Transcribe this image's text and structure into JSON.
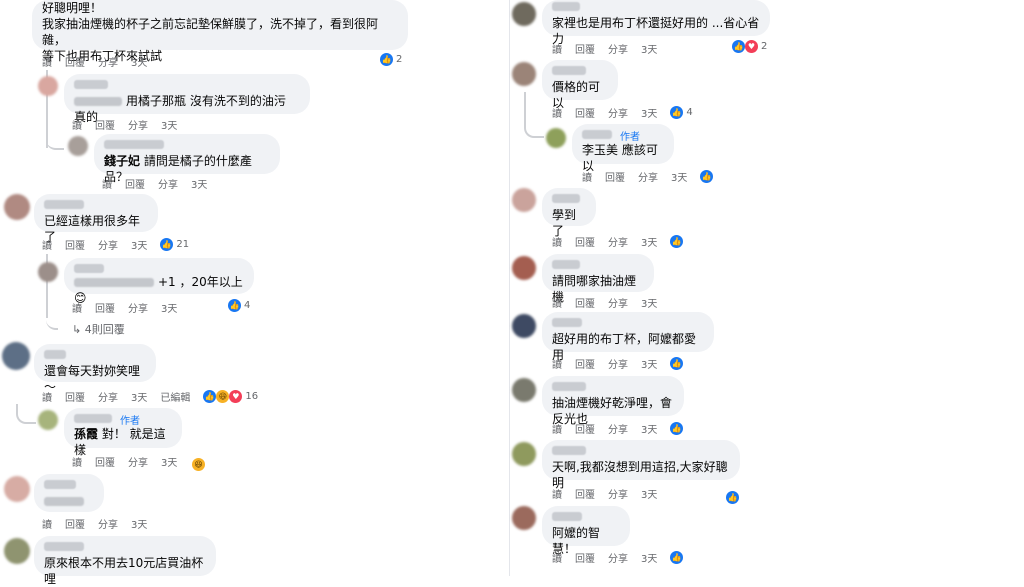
{
  "actions": {
    "read": "讀",
    "reply": "回覆",
    "share": "分享",
    "edited": "已編輯",
    "author": "作者"
  },
  "left": {
    "c1": {
      "line1": "好聰明哩！",
      "line2": "我家抽油煙機的杯子之前忘記墊保鮮膜了，洗不掉了，看到很阿雜，",
      "line3": "等下也用布丁杯來試試",
      "time": "3天",
      "count": "2"
    },
    "c2": {
      "text": "用橘子那瓶 沒有洗不到的油污 真的",
      "time": "3天"
    },
    "c3": {
      "mention": "錢子妃",
      "text": "請問是橘子的什麼產品？",
      "time": "3天"
    },
    "c4": {
      "text": "已經這樣用很多年了",
      "time": "3天",
      "count": "21"
    },
    "c5": {
      "text": "+1 ，20年以上😊",
      "time": "3天",
      "count": "4"
    },
    "more": {
      "text": "4則回覆"
    },
    "c6": {
      "text": "還會每天對妳笑哩～",
      "time": "3天",
      "count": "16"
    },
    "c7": {
      "mention": "孫霞",
      "text": "對！ 就是這樣",
      "time": "3天"
    },
    "c8": {
      "time": "3天"
    },
    "c9": {
      "text": "原來根本不用去10元店買油杯哩"
    }
  },
  "right": {
    "r1": {
      "text": "家裡也是用布丁杯還挺好用的 ...省心省力",
      "time": "3天",
      "count": "2"
    },
    "r2": {
      "text": "價格的可以",
      "time": "3天",
      "count": "4"
    },
    "r3": {
      "mention": "李玉美",
      "text": "應該可以",
      "time": "3天"
    },
    "r4": {
      "text": "學到了",
      "time": "3天"
    },
    "r5": {
      "text": "請問哪家抽油煙機",
      "time": "3天"
    },
    "r6": {
      "text": "超好用的布丁杯，阿嬤都愛用",
      "time": "3天"
    },
    "r7": {
      "text": "抽油煙機好乾淨哩，會反光也",
      "time": "3天"
    },
    "r8": {
      "text": "天啊,我都沒想到用這招,大家好聰明",
      "time": "3天"
    },
    "r9": {
      "text": "阿嬤的智慧！",
      "time": "3天"
    }
  },
  "colors": {
    "like": "#1877f2",
    "heart": "#f33e58",
    "haha": "#f7b125",
    "bubble": "#f0f2f5",
    "link": "#1877f2"
  }
}
